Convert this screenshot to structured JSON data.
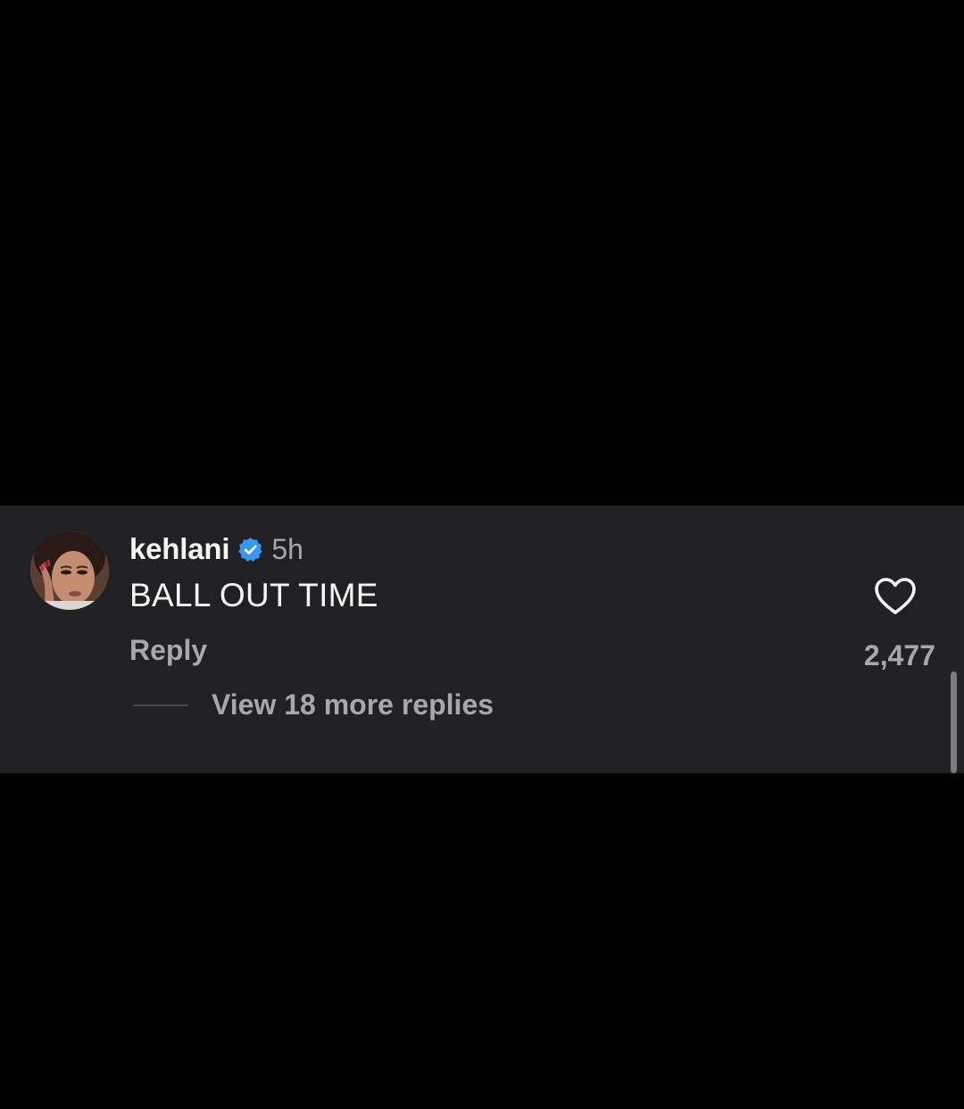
{
  "comment": {
    "username": "kehlani",
    "verified_icon": "verified-badge-icon",
    "timestamp": "5h",
    "text": "BALL OUT TIME",
    "reply_label": "Reply",
    "like_icon": "heart-icon",
    "like_count": "2,477",
    "view_replies_label": "View 18 more replies"
  },
  "colors": {
    "background": "#000000",
    "panel": "#212124",
    "primary_text": "#f5f5f5",
    "secondary_text": "#a8a8ab",
    "verified": "#3897f0"
  }
}
